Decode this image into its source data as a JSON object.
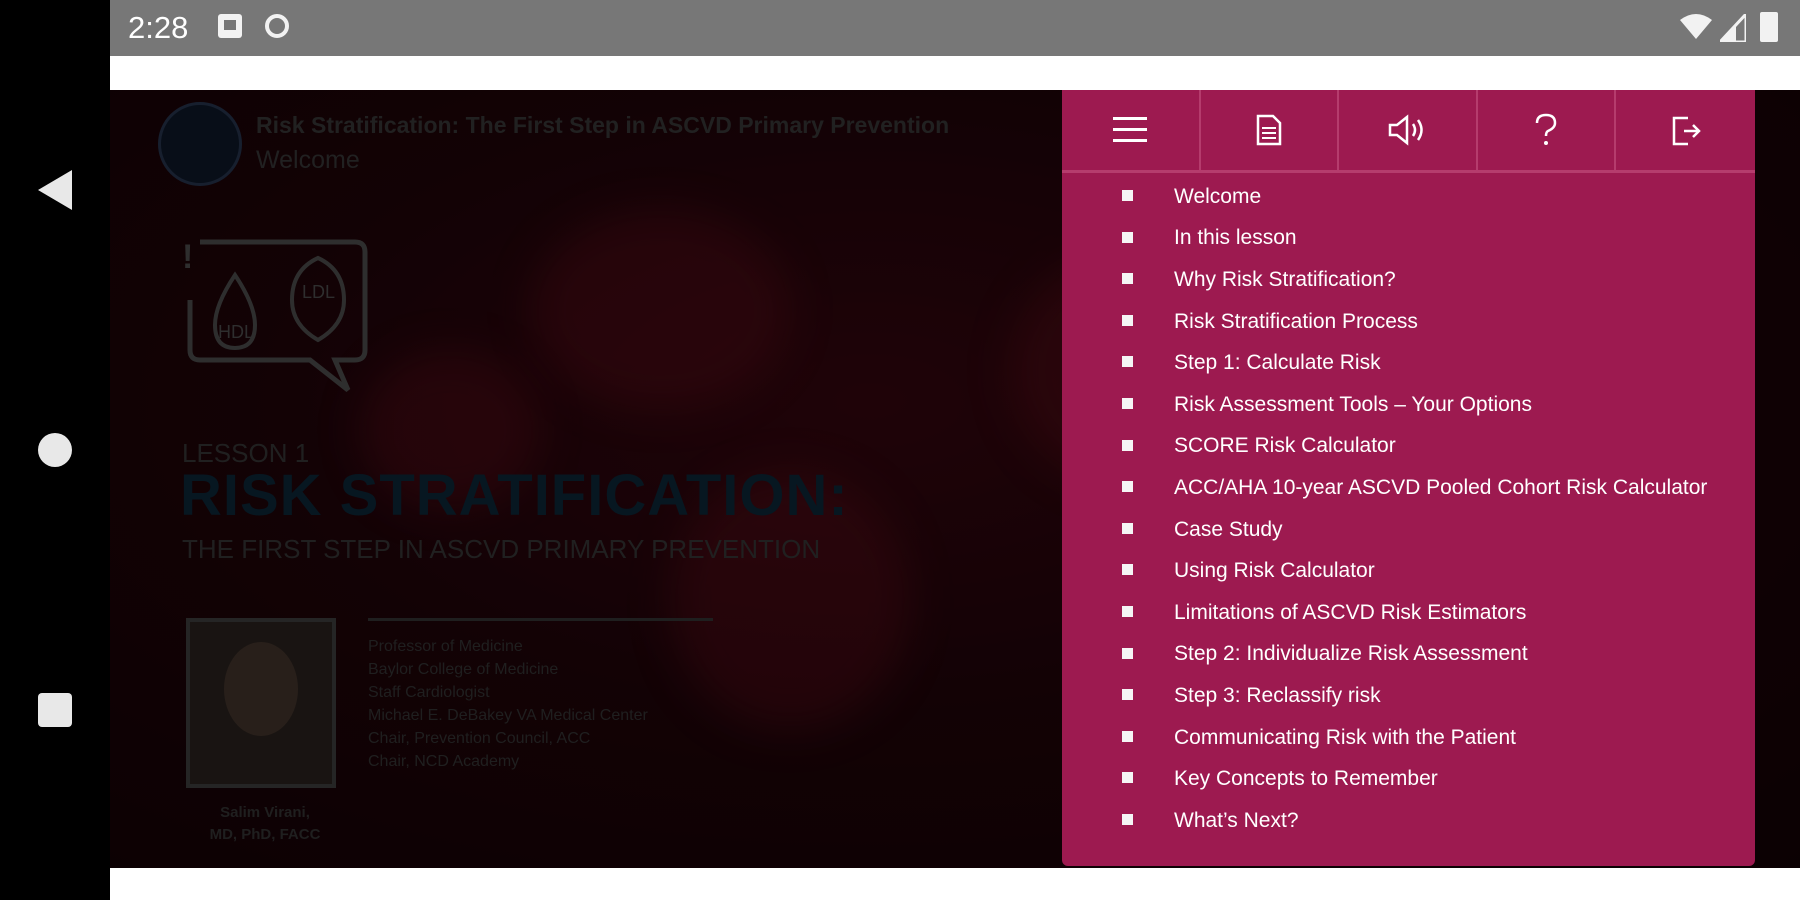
{
  "status_bar": {
    "time": "2:28",
    "icons": [
      "notification-image-icon",
      "sync-disabled-icon",
      "wifi-icon",
      "signal-icon",
      "battery-icon"
    ]
  },
  "nav_bar": {
    "icons": [
      "back-icon",
      "home-icon",
      "recents-icon"
    ]
  },
  "course": {
    "header_title": "Risk Stratification: The First Step in ASCVD Primary Prevention",
    "header_subtitle": "Welcome",
    "graphic_labels": {
      "hdl": "HDL",
      "ldl": "LDL",
      "alert": "!"
    },
    "lesson_label": "LESSON 1",
    "lesson_title": "RISK STRATIFICATION:",
    "lesson_subtitle": "THE FIRST STEP IN ASCVD PRIMARY PREVENTION",
    "speaker_name_line1": "Salim Virani,",
    "speaker_name_line2": "MD, PhD, FACC",
    "speaker_bio": [
      "Professor of Medicine",
      "Baylor College of Medicine",
      "Staff Cardiologist",
      "Michael E. DeBakey VA Medical Center",
      "Chair, Prevention Council, ACC",
      "Chair, NCD Academy"
    ]
  },
  "menu": {
    "toolbar": [
      {
        "name": "menu-icon"
      },
      {
        "name": "transcript-icon"
      },
      {
        "name": "audio-icon"
      },
      {
        "name": "help-icon"
      },
      {
        "name": "exit-icon"
      }
    ],
    "items": [
      "Welcome",
      "In this lesson",
      "Why Risk Stratification?",
      "Risk Stratification Process",
      "Step 1: Calculate Risk",
      "Risk Assessment Tools – Your Options",
      "SCORE Risk Calculator",
      "ACC/AHA 10-year ASCVD Pooled Cohort Risk Calculator",
      "Case Study",
      "Using Risk Calculator",
      "Limitations of ASCVD Risk Estimators",
      "Step 2: Individualize Risk Assessment",
      "Step 3: Reclassify risk",
      "Communicating Risk with the Patient",
      "Key Concepts to Remember",
      "What’s Next?"
    ]
  },
  "colors": {
    "menu_background": "#9d1a50",
    "status_bar": "#777777",
    "lesson_title": "#0e2a3c"
  }
}
